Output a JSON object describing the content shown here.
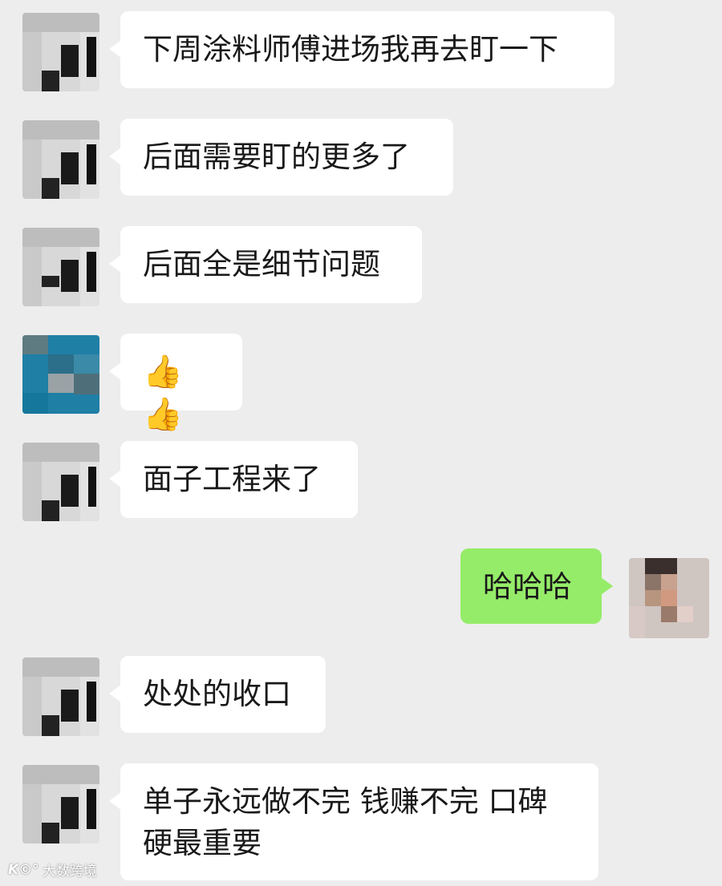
{
  "messages": [
    {
      "side": "left",
      "avatar": "gray",
      "text": "下周涂料师傅进场我再去盯一下"
    },
    {
      "side": "left",
      "avatar": "gray",
      "text": "后面需要盯的更多了"
    },
    {
      "side": "left",
      "avatar": "gray",
      "text": "后面全是细节问题"
    },
    {
      "side": "left",
      "avatar": "blue",
      "text": "👍👍"
    },
    {
      "side": "left",
      "avatar": "gray",
      "text": "面子工程来了"
    },
    {
      "side": "right",
      "avatar": "self",
      "text": "哈哈哈"
    },
    {
      "side": "left",
      "avatar": "gray",
      "text": "处处的收口"
    },
    {
      "side": "left",
      "avatar": "gray",
      "text": "单子永远做不完 钱赚不完 口碑硬最重要"
    }
  ],
  "watermark": {
    "logo": "K©°",
    "text": "大数跨境"
  },
  "colors": {
    "background": "#ededed",
    "bubble_in": "#ffffff",
    "bubble_out": "#95ec69",
    "text": "#191919"
  }
}
